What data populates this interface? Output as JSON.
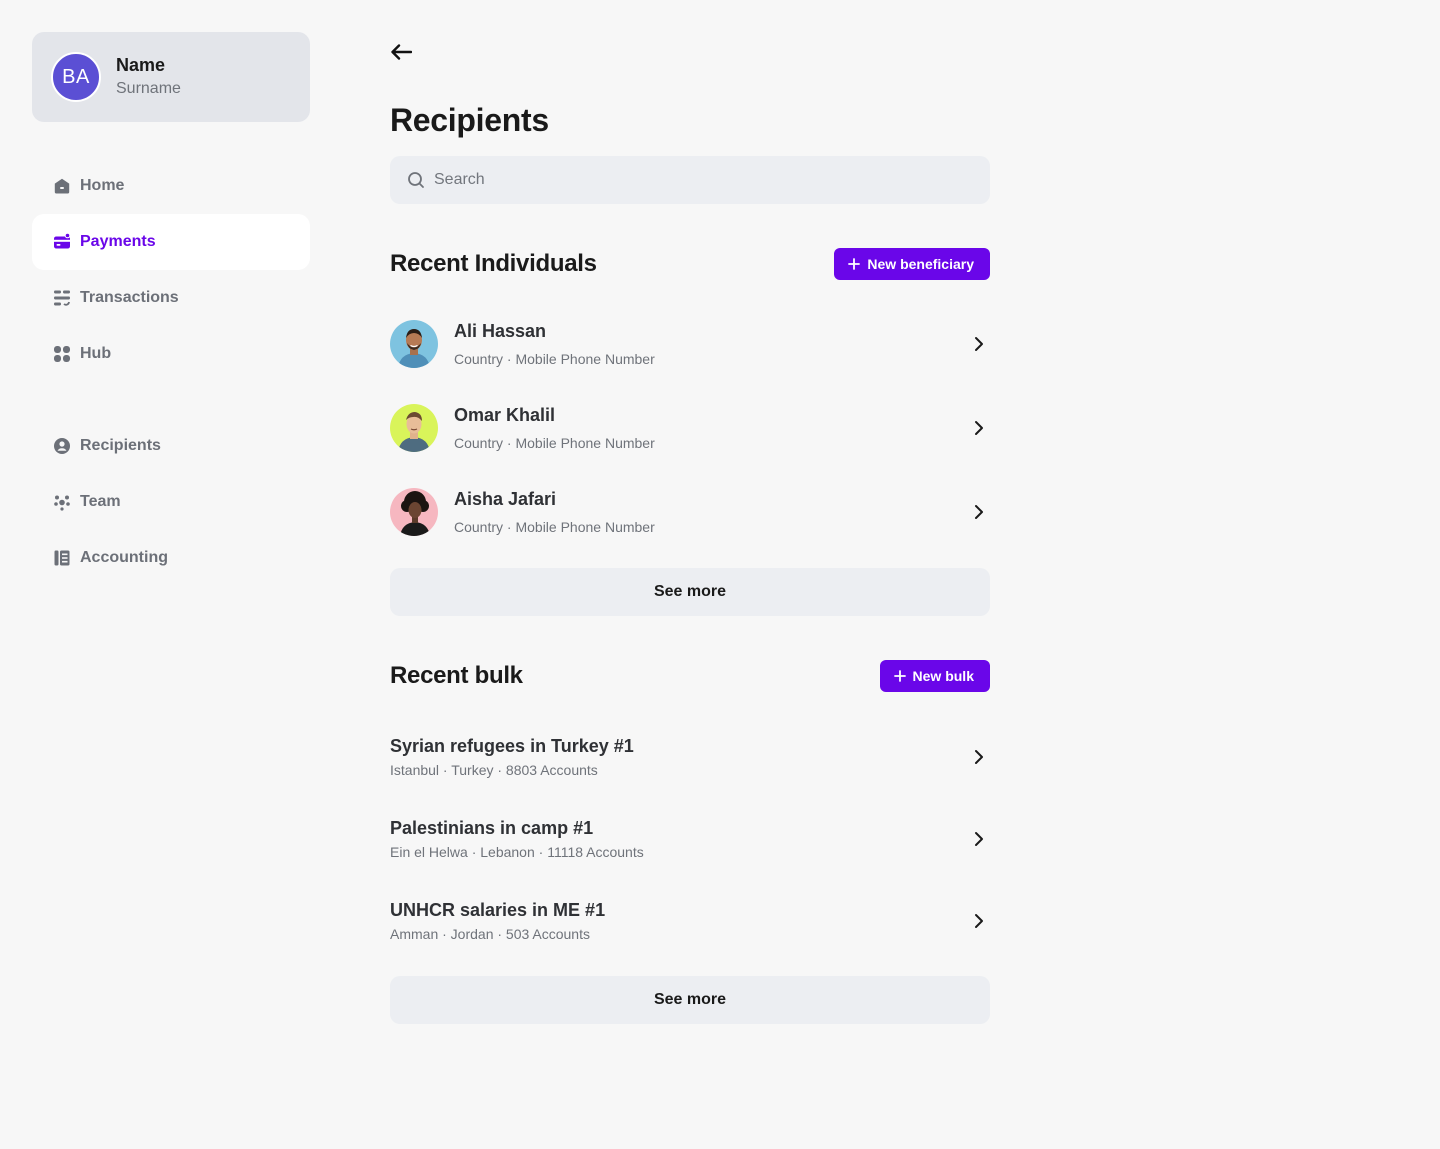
{
  "profile": {
    "initials": "BA",
    "name": "Name",
    "surname": "Surname"
  },
  "nav_primary": [
    {
      "label": "Home",
      "icon": "home-icon",
      "active": false
    },
    {
      "label": "Payments",
      "icon": "payments-icon",
      "active": true
    },
    {
      "label": "Transactions",
      "icon": "transactions-icon",
      "active": false
    },
    {
      "label": "Hub",
      "icon": "hub-icon",
      "active": false
    }
  ],
  "nav_secondary": [
    {
      "label": "Recipients",
      "icon": "recipients-icon",
      "active": false
    },
    {
      "label": "Team",
      "icon": "team-icon",
      "active": false
    },
    {
      "label": "Accounting",
      "icon": "accounting-icon",
      "active": false
    }
  ],
  "page": {
    "title": "Recipients"
  },
  "search": {
    "placeholder": "Search",
    "value": ""
  },
  "individuals": {
    "title": "Recent Individuals",
    "button_label": "New beneficiary",
    "items": [
      {
        "name": "Ali Hassan",
        "subtitle": "Country · Mobile Phone Number",
        "avatar_bg": "#7ec3e0"
      },
      {
        "name": "Omar Khalil",
        "subtitle": "Country · Mobile Phone Number",
        "avatar_bg": "#d9f45a"
      },
      {
        "name": "Aisha Jafari",
        "subtitle": "Country · Mobile Phone Number",
        "avatar_bg": "#f6b7c0"
      }
    ],
    "see_more": "See more"
  },
  "bulk": {
    "title": "Recent bulk",
    "button_label": "New bulk",
    "items": [
      {
        "name": "Syrian refugees in Turkey #1",
        "subtitle": "Istanbul · Turkey · 8803 Accounts"
      },
      {
        "name": "Palestinians in camp #1",
        "subtitle": "Ein el Helwa · Lebanon · 11118 Accounts"
      },
      {
        "name": "UNHCR salaries in ME #1",
        "subtitle": "Amman · Jordan · 503 Accounts"
      }
    ],
    "see_more": "See more"
  },
  "colors": {
    "accent": "#6a06e9",
    "avatar": "#5b4fd4",
    "background": "#f7f7f7",
    "surface": "#eceef2",
    "profile_card": "#e3e5ea",
    "muted_text": "#6f737a"
  }
}
